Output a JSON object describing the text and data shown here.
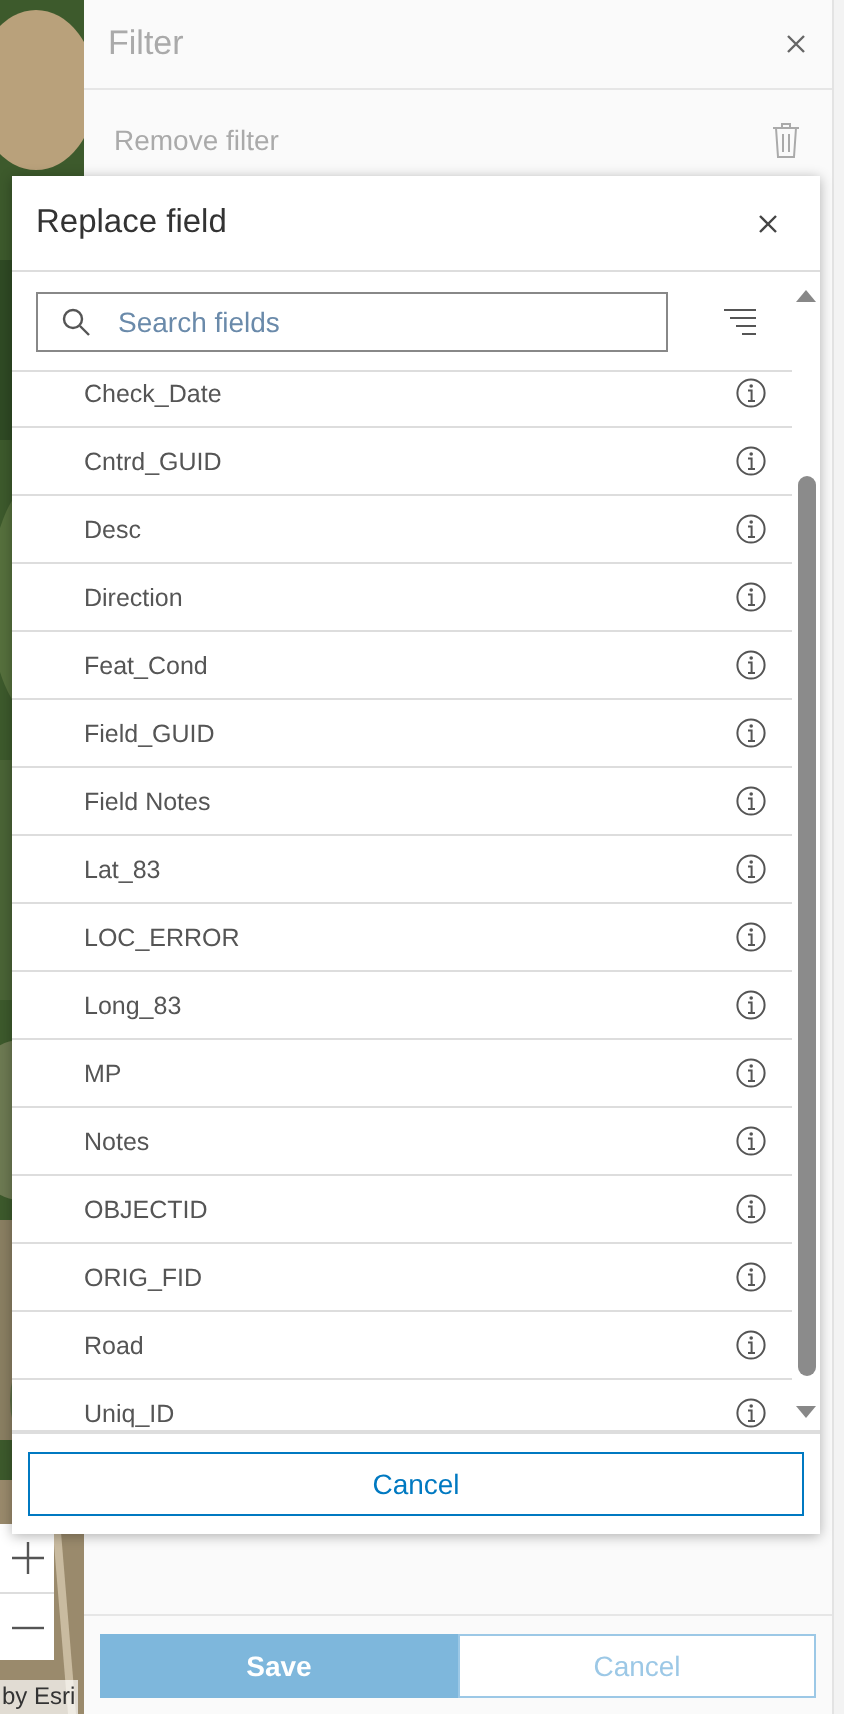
{
  "map": {
    "attribution": "by Esri"
  },
  "panel": {
    "title": "Filter",
    "remove_label": "Remove filter"
  },
  "dialog": {
    "title": "Replace field",
    "search": {
      "placeholder": "Search fields"
    },
    "fields": [
      "Check_Date",
      "Cntrd_GUID",
      "Desc",
      "Direction",
      "Feat_Cond",
      "Field_GUID",
      "Field Notes",
      "Lat_83",
      "LOC_ERROR",
      "Long_83",
      "MP",
      "Notes",
      "OBJECTID",
      "ORIG_FID",
      "Road",
      "Uniq_ID"
    ],
    "cancel": "Cancel"
  },
  "footer": {
    "save": "Save",
    "save_disabled": true,
    "cancel": "Cancel"
  }
}
